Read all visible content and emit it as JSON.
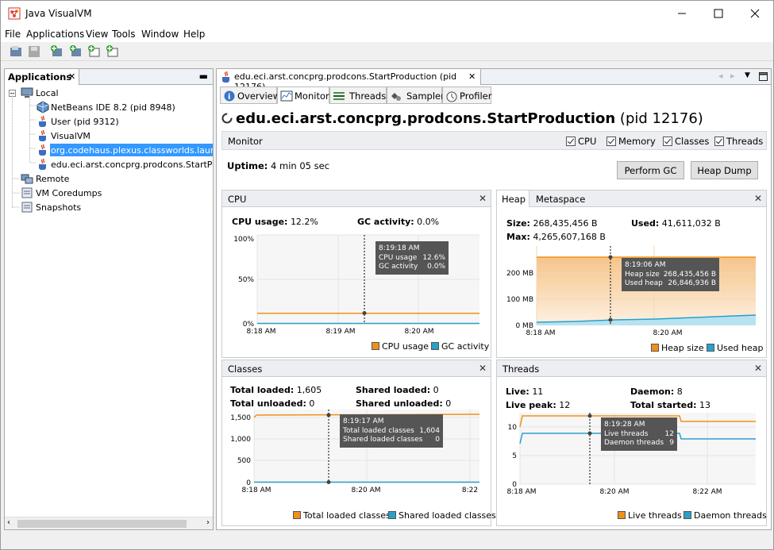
{
  "window": {
    "title": "Java VisualVM"
  },
  "menu": [
    "File",
    "Applications",
    "View",
    "Tools",
    "Window",
    "Help"
  ],
  "left": {
    "tab_label": "Applications",
    "tree": [
      {
        "label": "Local",
        "icon": "computer-icon",
        "selected": false
      },
      {
        "label": "NetBeans IDE 8.2 (pid 8948)",
        "icon": "netbeans-icon",
        "selected": false
      },
      {
        "label": "User (pid 9312)",
        "icon": "java-cup-icon",
        "selected": false
      },
      {
        "label": "VisualVM",
        "icon": "visualvm-icon",
        "selected": false
      },
      {
        "label": "org.codehaus.plexus.classworlds.launcher",
        "icon": "java-cup-icon",
        "selected": true
      },
      {
        "label": "edu.eci.arst.concprg.prodcons.StartProdu",
        "icon": "java-cup-icon",
        "selected": false
      },
      {
        "label": "Remote",
        "icon": "network-icon",
        "selected": false
      },
      {
        "label": "VM Coredumps",
        "icon": "coredump-icon",
        "selected": false
      },
      {
        "label": "Snapshots",
        "icon": "snapshot-icon",
        "selected": false
      }
    ]
  },
  "doc_tab": {
    "label": "edu.eci.arst.concprg.prodcons.StartProduction (pid 12176)"
  },
  "subtabs": [
    "Overview",
    "Monitor",
    "Threads",
    "Sampler",
    "Profiler"
  ],
  "heading": {
    "name": "edu.eci.arst.concprg.prodcons.StartProduction",
    "pid": "(pid 12176)"
  },
  "monitor": {
    "label": "Monitor",
    "checks": [
      "CPU",
      "Memory",
      "Classes",
      "Threads"
    ],
    "uptime_label": "Uptime:",
    "uptime_value": "4 min 05 sec",
    "perform_gc": "Perform GC",
    "heap_dump": "Heap Dump"
  },
  "cpu": {
    "title": "CPU",
    "usage_label": "CPU usage:",
    "usage_value": "12.2%",
    "gc_label": "GC activity:",
    "gc_value": "0.0%",
    "tooltip": {
      "time": "8:19:18 AM",
      "r1k": "CPU usage",
      "r1v": "12.6%",
      "r2k": "GC activity",
      "r2v": "0.0%"
    },
    "legend": [
      "CPU usage",
      "GC activity"
    ]
  },
  "heap": {
    "tab1": "Heap",
    "tab2": "Metaspace",
    "size_label": "Size:",
    "size_value": "268,435,456 B",
    "used_label": "Used:",
    "used_value": "41,611,032 B",
    "max_label": "Max:",
    "max_value": "4,265,607,168 B",
    "tooltip": {
      "time": "8:19:06 AM",
      "r1k": "Heap size",
      "r1v": "268,435,456 B",
      "r2k": "Used heap",
      "r2v": "26,846,936 B"
    },
    "legend": [
      "Heap size",
      "Used heap"
    ]
  },
  "classes": {
    "title": "Classes",
    "tl_label": "Total loaded:",
    "tl_value": "1,605",
    "tu_label": "Total unloaded:",
    "tu_value": "0",
    "sl_label": "Shared loaded:",
    "sl_value": "0",
    "su_label": "Shared unloaded:",
    "su_value": "0",
    "tooltip": {
      "time": "8:19:17 AM",
      "r1k": "Total loaded classes",
      "r1v": "1,604",
      "r2k": "Shared loaded classes",
      "r2v": "0"
    },
    "legend": [
      "Total loaded classes",
      "Shared loaded classes"
    ]
  },
  "threads": {
    "title": "Threads",
    "live_label": "Live:",
    "live_value": "11",
    "daemon_label": "Daemon:",
    "daemon_value": "8",
    "peak_label": "Live peak:",
    "peak_value": "12",
    "started_label": "Total started:",
    "started_value": "13",
    "tooltip": {
      "time": "8:19:28 AM",
      "r1k": "Live threads",
      "r1v": "12",
      "r2k": "Daemon threads",
      "r2v": "9"
    },
    "legend": [
      "Live threads",
      "Daemon threads"
    ]
  },
  "chart_data": [
    {
      "type": "line",
      "title": "CPU",
      "x": [
        "8:18 AM",
        "8:19 AM",
        "8:20 AM"
      ],
      "y_ticks": [
        "0%",
        "50%",
        "100%"
      ],
      "ylim": [
        0,
        100
      ],
      "series": [
        {
          "name": "CPU usage",
          "values": [
            12.2,
            12.6,
            12.2
          ]
        },
        {
          "name": "GC activity",
          "values": [
            0,
            0,
            0
          ]
        }
      ],
      "colors": {
        "CPU usage": "#f0901a",
        "GC activity": "#2aa0c8"
      }
    },
    {
      "type": "area",
      "title": "Heap",
      "x": [
        "8:18 AM",
        "8:20 AM"
      ],
      "y_ticks": [
        "0 MB",
        "100 MB",
        "200 MB"
      ],
      "series": [
        {
          "name": "Heap size",
          "values": [
            268.4,
            268.4
          ]
        },
        {
          "name": "Used heap",
          "values": [
            12,
            41.6
          ]
        }
      ],
      "colors": {
        "Heap size": "#f0901a",
        "Used heap": "#2aa0c8"
      }
    },
    {
      "type": "line",
      "title": "Classes",
      "x": [
        "8:18 AM",
        "8:20 AM",
        "8:22"
      ],
      "y_ticks": [
        "0",
        "500",
        "1,000",
        "1,500"
      ],
      "series": [
        {
          "name": "Total loaded classes",
          "values": [
            1590,
            1604,
            1605
          ]
        },
        {
          "name": "Shared loaded classes",
          "values": [
            0,
            0,
            0
          ]
        }
      ],
      "colors": {
        "Total loaded classes": "#f0901a",
        "Shared loaded classes": "#2aa0c8"
      }
    },
    {
      "type": "line",
      "title": "Threads",
      "x": [
        "8:18 AM",
        "8:20 AM",
        "8:22 AM"
      ],
      "y_ticks": [
        "0",
        "5",
        "10"
      ],
      "series": [
        {
          "name": "Live threads",
          "values": [
            10,
            12,
            11
          ]
        },
        {
          "name": "Daemon threads",
          "values": [
            7,
            9,
            8
          ]
        }
      ],
      "colors": {
        "Live threads": "#f0901a",
        "Daemon threads": "#2aa0c8"
      }
    }
  ]
}
